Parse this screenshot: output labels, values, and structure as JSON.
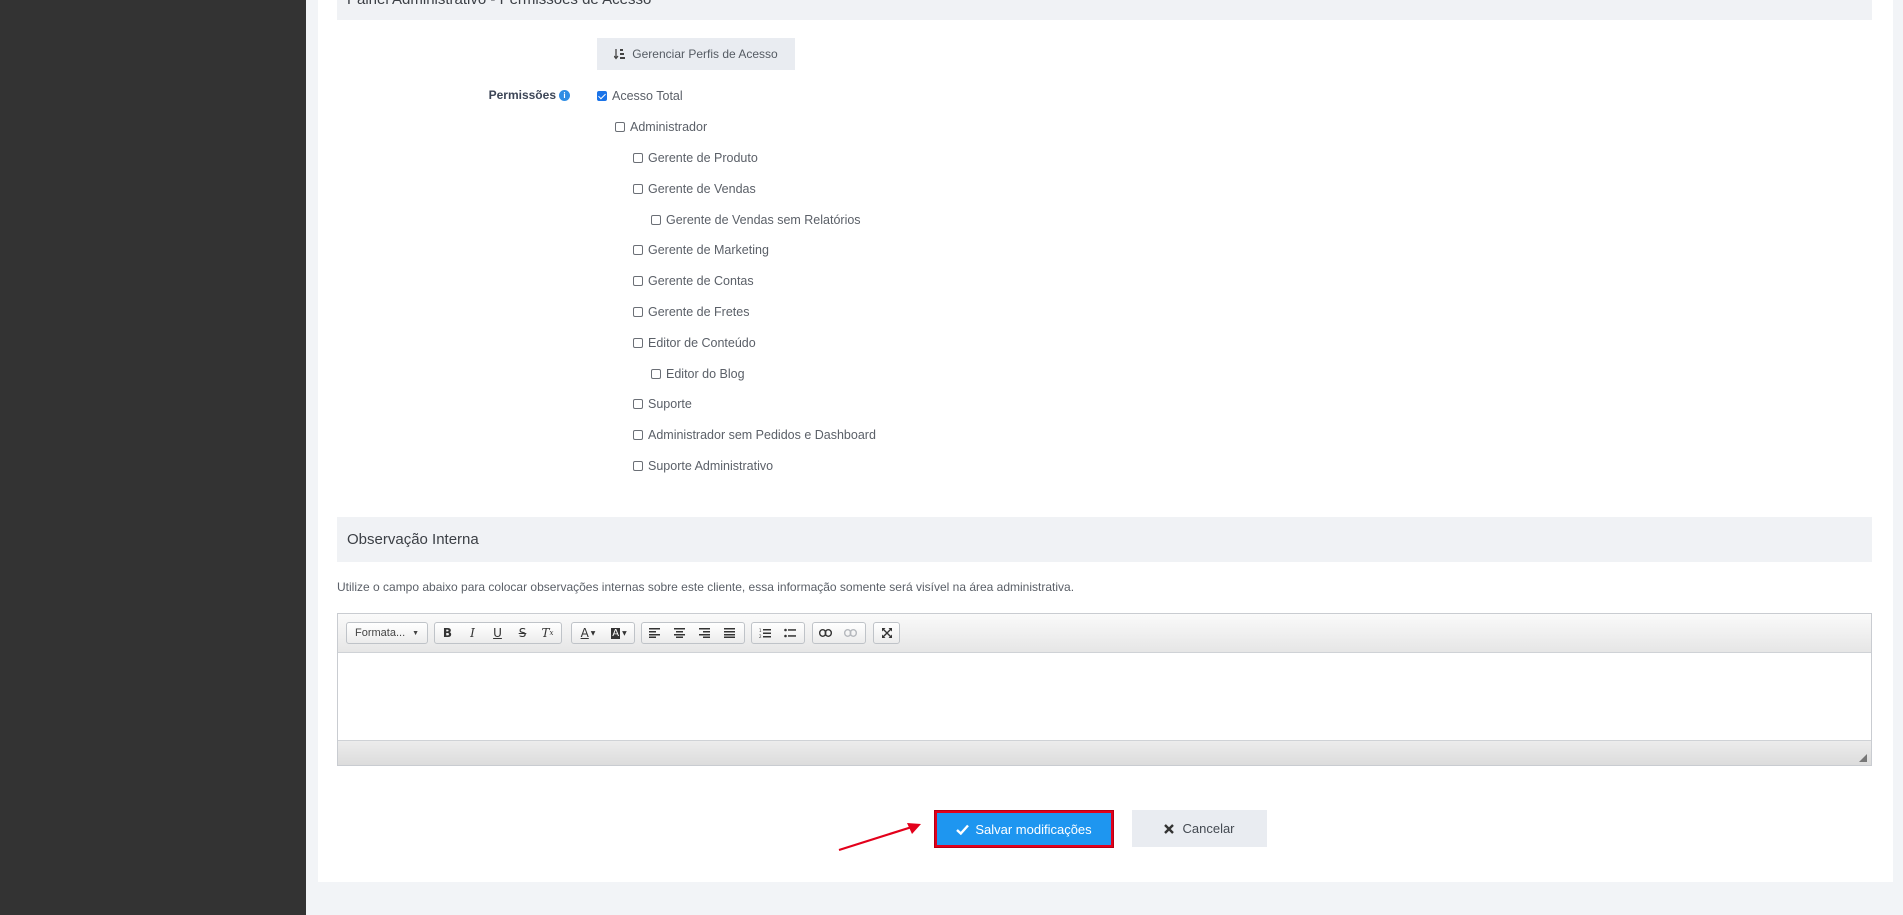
{
  "section_top": {
    "title": "Painel Administrativo - Permissões de Acesso"
  },
  "manage_button": {
    "label": "Gerenciar Perfis de Acesso",
    "icon": "sort-icon"
  },
  "permissions": {
    "label": "Permissões",
    "items": [
      {
        "label": "Acesso Total",
        "checked": true,
        "level": 0
      },
      {
        "label": "Administrador",
        "checked": false,
        "level": 1
      },
      {
        "label": "Gerente de Produto",
        "checked": false,
        "level": 2
      },
      {
        "label": "Gerente de Vendas",
        "checked": false,
        "level": 2
      },
      {
        "label": "Gerente de Vendas sem Relatórios",
        "checked": false,
        "level": 3
      },
      {
        "label": "Gerente de Marketing",
        "checked": false,
        "level": 2
      },
      {
        "label": "Gerente de Contas",
        "checked": false,
        "level": 2
      },
      {
        "label": "Gerente de Fretes",
        "checked": false,
        "level": 2
      },
      {
        "label": "Editor de Conteúdo",
        "checked": false,
        "level": 2
      },
      {
        "label": "Editor do Blog",
        "checked": false,
        "level": 3
      },
      {
        "label": "Suporte",
        "checked": false,
        "level": 2
      },
      {
        "label": "Administrador sem Pedidos e Dashboard",
        "checked": false,
        "level": 2
      },
      {
        "label": "Suporte Administrativo",
        "checked": false,
        "level": 2
      }
    ]
  },
  "observacao": {
    "title": "Observação Interna",
    "description": "Utilize o campo abaixo para colocar observações internas sobre este cliente, essa informação somente será visível na área administrativa.",
    "editor": {
      "format_label": "Formata...",
      "content": ""
    }
  },
  "actions": {
    "save_label": "Salvar modificações",
    "cancel_label": "Cancelar"
  },
  "colors": {
    "accent": "#1e96f0",
    "highlight": "#e3001b",
    "sidebar": "#333333"
  }
}
